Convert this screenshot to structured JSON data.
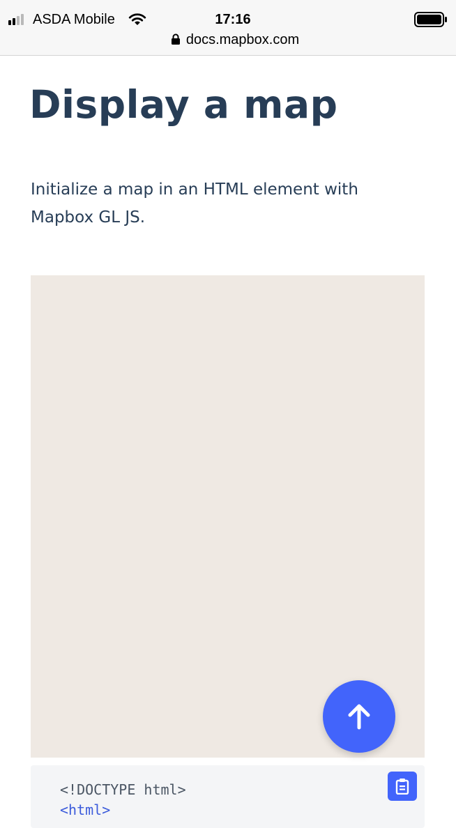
{
  "status_bar": {
    "carrier": "ASDA Mobile",
    "time": "17:16",
    "url": "docs.mapbox.com"
  },
  "page": {
    "title": "Display a map",
    "intro": "Initialize a map in an HTML element with Mapbox GL JS."
  },
  "code": {
    "lines": [
      "<!DOCTYPE html>",
      "<html>"
    ]
  },
  "icons": {
    "signal": "cellular-signal-icon",
    "wifi": "wifi-icon",
    "battery": "battery-icon",
    "lock": "lock-icon",
    "copy": "clipboard-icon",
    "scroll_top": "arrow-up-icon"
  },
  "colors": {
    "accent": "#4264fb",
    "heading": "#273d56",
    "map_background": "#efe9e3",
    "code_background": "#f4f5f7"
  }
}
